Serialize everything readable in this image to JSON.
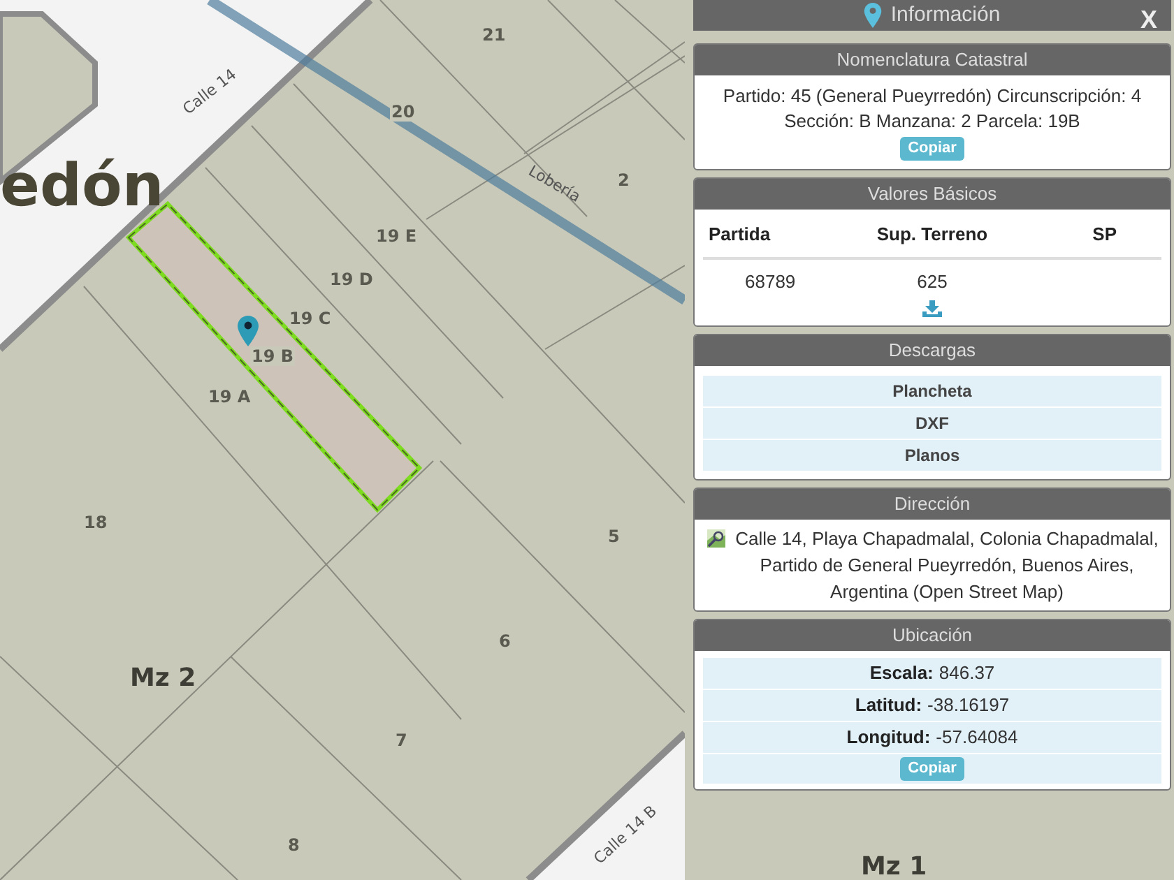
{
  "map": {
    "place_label": "edón",
    "streets": [
      "Calle 14",
      "Lobería",
      "Calle 14 B"
    ],
    "parcels": [
      "21",
      "20",
      "2",
      "19 E",
      "19 D",
      "19 C",
      "19 B",
      "19 A",
      "18",
      "5",
      "6",
      "7",
      "8"
    ],
    "blocks": [
      "Mz 2",
      "Mz 1"
    ]
  },
  "panel": {
    "title": "Información",
    "close": "X",
    "sections": [
      {
        "kind": "text",
        "title": "Nomenclatura Catastral",
        "text": "Partido: 45 (General Pueyrredón) Circunscripción: 4 Sección: B Manzana: 2 Parcela: 19B",
        "button": "Copiar"
      },
      {
        "kind": "table",
        "title": "Valores Básicos",
        "columns": [
          "Partida",
          "Sup. Terreno",
          "SP"
        ],
        "rows": [
          [
            "68789",
            "625"
          ]
        ]
      },
      {
        "kind": "links",
        "title": "Descargas",
        "items": [
          "Plancheta",
          "DXF",
          "Planos"
        ]
      },
      {
        "kind": "address",
        "title": "Dirección",
        "text": "Calle 14, Playa Chapadmalal, Colonia Chapadmalal, Partido de General Pueyrredón, Buenos Aires, Argentina (Open Street Map)"
      },
      {
        "kind": "fields",
        "title": "Ubicación",
        "items": [
          {
            "label": "Escala:",
            "value": "846.37"
          },
          {
            "label": "Latitud:",
            "value": "-38.16197"
          },
          {
            "label": "Longitud:",
            "value": "-57.64084"
          }
        ],
        "button": "Copiar"
      }
    ]
  }
}
